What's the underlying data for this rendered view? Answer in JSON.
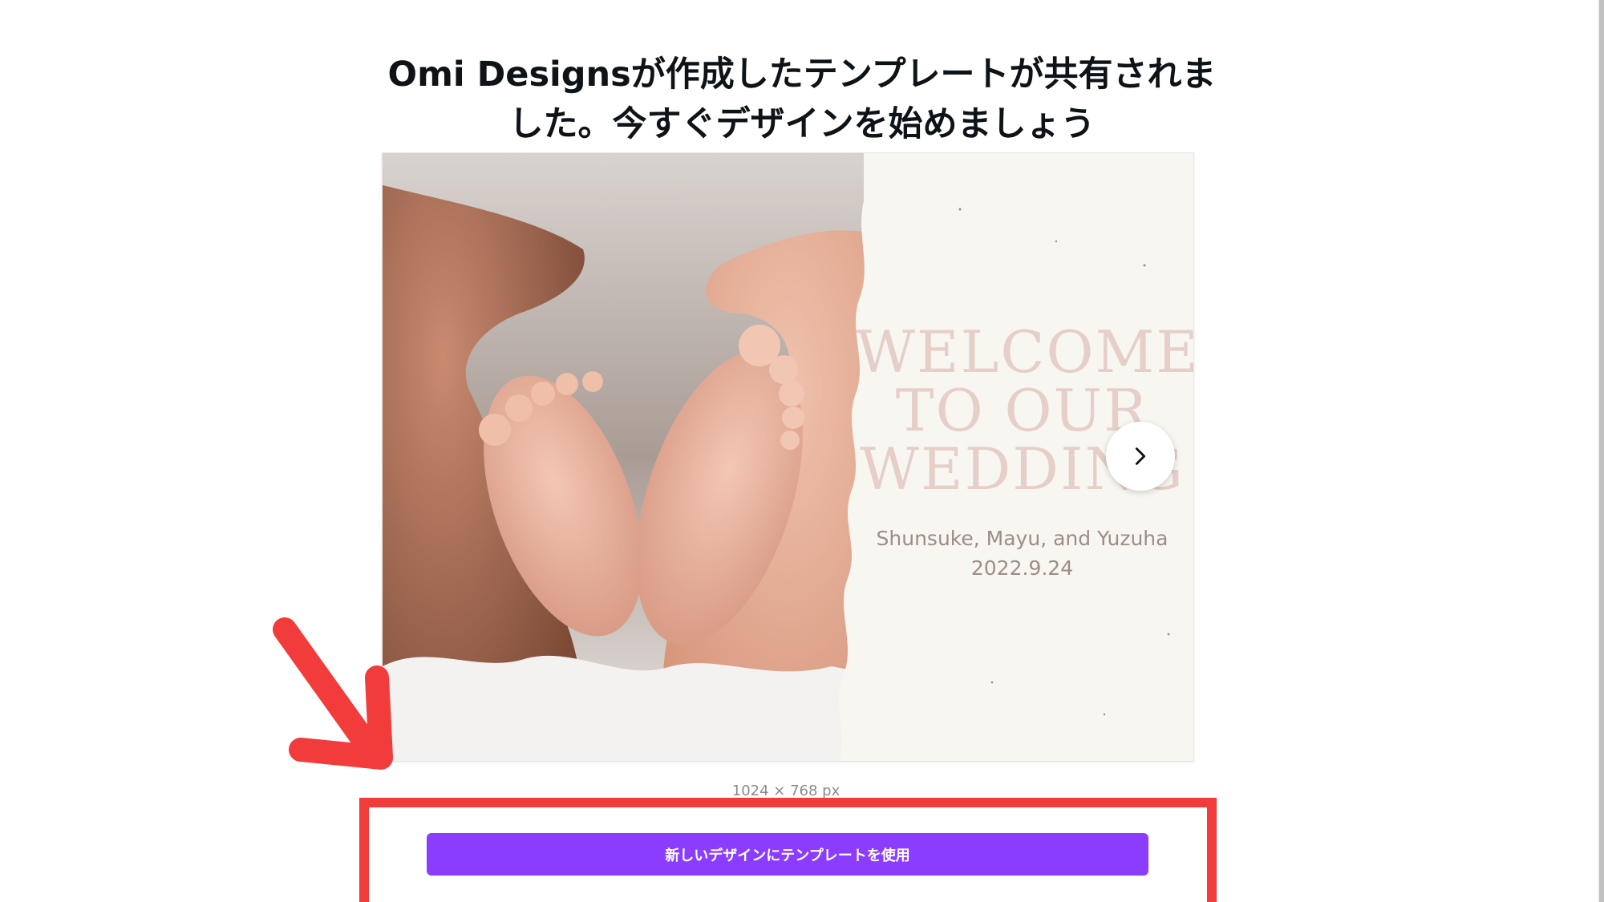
{
  "heading": {
    "line1": "Omi Designsが作成したテンプレートが共有されま",
    "line2": "した。今すぐデザインを始めましょう"
  },
  "preview": {
    "welcome_lines": [
      "WELCOME",
      "TO OUR",
      "WEDDING"
    ],
    "names": "Shunsuke, Mayu, and Yuzuha",
    "date": "2022.9.24",
    "next_icon": "chevron-right-icon"
  },
  "size_label": "1024 × 768 px",
  "cta": {
    "label": "新しいデザインにテンプレートを使用"
  },
  "colors": {
    "cta_bg": "#8b3dff",
    "highlight": "#f23b3b",
    "welcome_text": "#e7cfc9"
  }
}
